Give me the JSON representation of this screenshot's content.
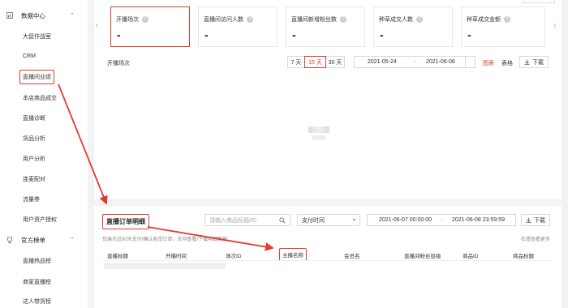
{
  "sidebar": {
    "groups": [
      {
        "label": "数据中心",
        "icon": "bar-chart-icon"
      },
      {
        "label": "官方榜单",
        "icon": "trophy-icon"
      }
    ],
    "data_center_items": [
      "大促作战室",
      "CRM",
      "直播间业绩",
      "本店商品成交",
      "直播诊断",
      "货品分析",
      "用户分析",
      "连麦配对",
      "流量券",
      "用户资产授权"
    ],
    "rank_items": [
      "直播热品榜",
      "商家直播榜",
      "达人带货榜"
    ]
  },
  "metrics": [
    {
      "label": "开播场次",
      "value": "-"
    },
    {
      "label": "直播间访问人数",
      "value": "-"
    },
    {
      "label": "直播间新增粉丝数",
      "value": "-"
    },
    {
      "label": "种草成交人数",
      "value": "-"
    },
    {
      "label": "种草成交金额",
      "value": "-"
    }
  ],
  "trend": {
    "label": "开播场次",
    "periods": [
      "7 天",
      "15 天",
      "30 天"
    ],
    "active_period": "15 天",
    "date_start": "2021-05-24",
    "date_sep": "-",
    "date_end": "2021-06-08",
    "view_chart": "图表",
    "view_table": "表格",
    "download": "下载"
  },
  "orders": {
    "title": "直播订单明细",
    "search_placeholder": "请输入商品标题/ID",
    "time_type": "支付时间",
    "date_start": "2021-06-07 00:00:00",
    "date_sep": "-",
    "date_end": "2021-06-08 23:59:59",
    "download": "下载",
    "note": "仅展示近90天支付/确认收货订单，支持查看/下载明细数据",
    "note_right": "右滑查看更多",
    "columns": [
      "直播标题",
      "开播时间",
      "场次ID",
      "主播名称",
      "会员名",
      "直播间粉丝层级",
      "商品ID",
      "商品标题"
    ]
  },
  "colors": {
    "accent": "#e23b2d"
  }
}
